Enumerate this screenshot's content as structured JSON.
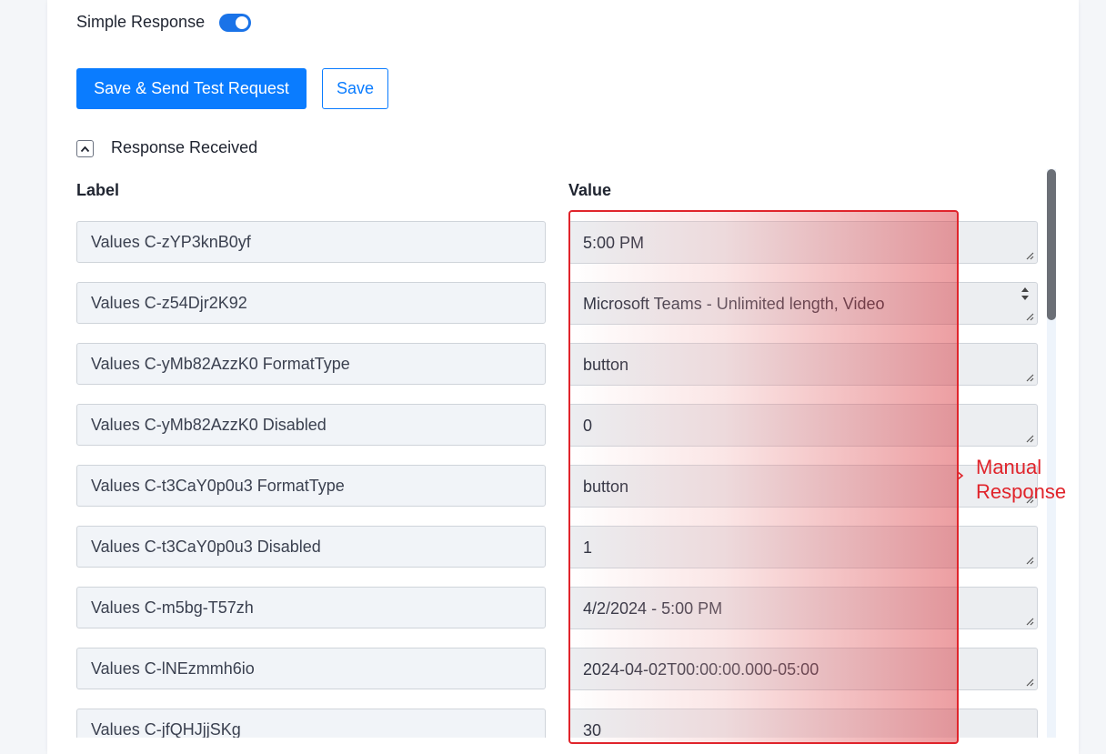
{
  "settings": {
    "simple_response_label": "Simple Response",
    "simple_response_on": true
  },
  "actions": {
    "save_send_label": "Save & Send Test Request",
    "save_label": "Save"
  },
  "section": {
    "title": "Response Received",
    "expanded": true
  },
  "table": {
    "label_header": "Label",
    "value_header": "Value",
    "rows": [
      {
        "label": "Values C-zYP3knB0yf",
        "value": "5:00 PM"
      },
      {
        "label": "Values C-z54Djr2K92",
        "value": "Microsoft Teams - Unlimited length, Video"
      },
      {
        "label": "Values C-yMb82AzzK0 FormatType",
        "value": "button"
      },
      {
        "label": "Values C-yMb82AzzK0 Disabled",
        "value": "0"
      },
      {
        "label": "Values C-t3CaY0p0u3 FormatType",
        "value": "button"
      },
      {
        "label": "Values C-t3CaY0p0u3 Disabled",
        "value": "1"
      },
      {
        "label": "Values C-m5bg-T57zh",
        "value": "4/2/2024 - 5:00 PM"
      },
      {
        "label": "Values C-lNEzmmh6io",
        "value": "2024-04-02T00:00:00.000-05:00"
      },
      {
        "label": "Values C-jfQHJjjSKg",
        "value": "30"
      }
    ]
  },
  "annotation": {
    "text_line1": "Manual",
    "text_line2": "Response",
    "color": "#e0242b"
  },
  "colors": {
    "primary": "#0a7cff",
    "toggle": "#1a73e8"
  }
}
